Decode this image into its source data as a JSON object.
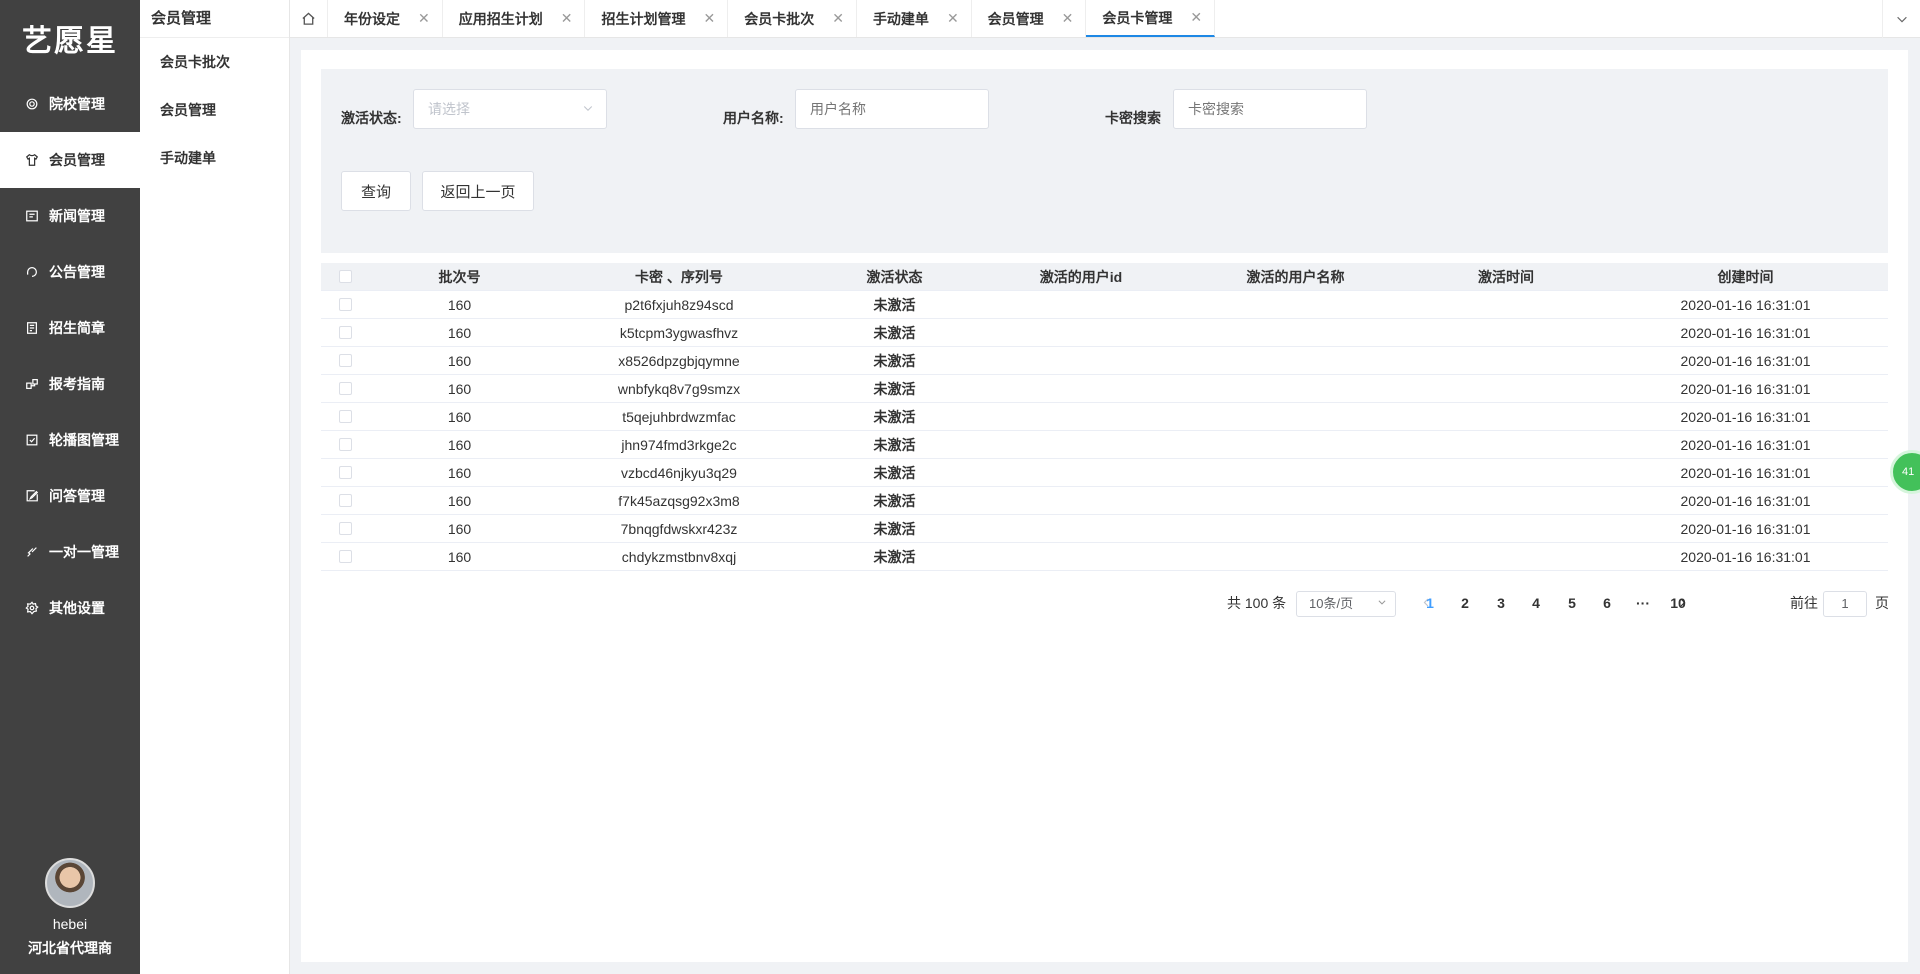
{
  "sidebar": {
    "logo": "艺愿星",
    "items": [
      {
        "label": "院校管理",
        "icon": "gear-icon",
        "active": false
      },
      {
        "label": "会员管理",
        "icon": "shirt-icon",
        "active": true
      },
      {
        "label": "新闻管理",
        "icon": "news-icon",
        "active": false
      },
      {
        "label": "公告管理",
        "icon": "notice-icon",
        "active": false
      },
      {
        "label": "招生简章",
        "icon": "document-icon",
        "active": false
      },
      {
        "label": "报考指南",
        "icon": "guide-icon",
        "active": false
      },
      {
        "label": "轮播图管理",
        "icon": "carousel-icon",
        "active": false
      },
      {
        "label": "问答管理",
        "icon": "edit-icon",
        "active": false
      },
      {
        "label": "一对一管理",
        "icon": "pen-icon",
        "active": false
      },
      {
        "label": "其他设置",
        "icon": "settings-icon",
        "active": false
      }
    ],
    "user": {
      "name": "hebei",
      "role": "河北省代理商"
    }
  },
  "submenu": {
    "title": "会员管理",
    "items": [
      "会员卡批次",
      "会员管理",
      "手动建单"
    ]
  },
  "tabs": [
    {
      "label": "年份设定",
      "active": false
    },
    {
      "label": "应用招生计划",
      "active": false
    },
    {
      "label": "招生计划管理",
      "active": false
    },
    {
      "label": "会员卡批次",
      "active": false
    },
    {
      "label": "手动建单",
      "active": false
    },
    {
      "label": "会员管理",
      "active": false
    },
    {
      "label": "会员卡管理",
      "active": true
    }
  ],
  "filter": {
    "status_label": "激活状态:",
    "status_placeholder": "请选择",
    "username_label": "用户名称:",
    "username_placeholder": "用户名称",
    "card_label": "卡密搜索",
    "card_placeholder": "卡密搜索",
    "query_button": "查询",
    "back_button": "返回上一页"
  },
  "table": {
    "columns": [
      "批次号",
      "卡密 、序列号",
      "激活状态",
      "激活的用户id",
      "激活的用户名称",
      "激活时间",
      "创建时间"
    ],
    "rows": [
      {
        "batch": "160",
        "card": "p2t6fxjuh8z94scd",
        "status": "未激活",
        "user_id": "",
        "user_name": "",
        "activated_at": "",
        "created_at": "2020-01-16 16:31:01"
      },
      {
        "batch": "160",
        "card": "k5tcpm3ygwasfhvz",
        "status": "未激活",
        "user_id": "",
        "user_name": "",
        "activated_at": "",
        "created_at": "2020-01-16 16:31:01"
      },
      {
        "batch": "160",
        "card": "x8526dpzgbjqymne",
        "status": "未激活",
        "user_id": "",
        "user_name": "",
        "activated_at": "",
        "created_at": "2020-01-16 16:31:01"
      },
      {
        "batch": "160",
        "card": "wnbfykq8v7g9smzx",
        "status": "未激活",
        "user_id": "",
        "user_name": "",
        "activated_at": "",
        "created_at": "2020-01-16 16:31:01"
      },
      {
        "batch": "160",
        "card": "t5qejuhbrdwzmfac",
        "status": "未激活",
        "user_id": "",
        "user_name": "",
        "activated_at": "",
        "created_at": "2020-01-16 16:31:01"
      },
      {
        "batch": "160",
        "card": "jhn974fmd3rkge2c",
        "status": "未激活",
        "user_id": "",
        "user_name": "",
        "activated_at": "",
        "created_at": "2020-01-16 16:31:01"
      },
      {
        "batch": "160",
        "card": "vzbcd46njkyu3q29",
        "status": "未激活",
        "user_id": "",
        "user_name": "",
        "activated_at": "",
        "created_at": "2020-01-16 16:31:01"
      },
      {
        "batch": "160",
        "card": "f7k45azqsg92x3m8",
        "status": "未激活",
        "user_id": "",
        "user_name": "",
        "activated_at": "",
        "created_at": "2020-01-16 16:31:01"
      },
      {
        "batch": "160",
        "card": "7bnqgfdwskxr423z",
        "status": "未激活",
        "user_id": "",
        "user_name": "",
        "activated_at": "",
        "created_at": "2020-01-16 16:31:01"
      },
      {
        "batch": "160",
        "card": "chdykzmstbnv8xqj",
        "status": "未激活",
        "user_id": "",
        "user_name": "",
        "activated_at": "",
        "created_at": "2020-01-16 16:31:01"
      }
    ]
  },
  "pagination": {
    "total_text": "共 100 条",
    "page_size": "10条/页",
    "pages": [
      "1",
      "2",
      "3",
      "4",
      "5",
      "6",
      "···",
      "10"
    ],
    "current": "1",
    "goto_prefix": "前往",
    "goto_value": "1",
    "goto_suffix": "页"
  },
  "float_badge": "41",
  "colors": {
    "sidebar_bg": "#414141",
    "accent": "#409eff",
    "filter_bg": "#f0f2f5"
  }
}
